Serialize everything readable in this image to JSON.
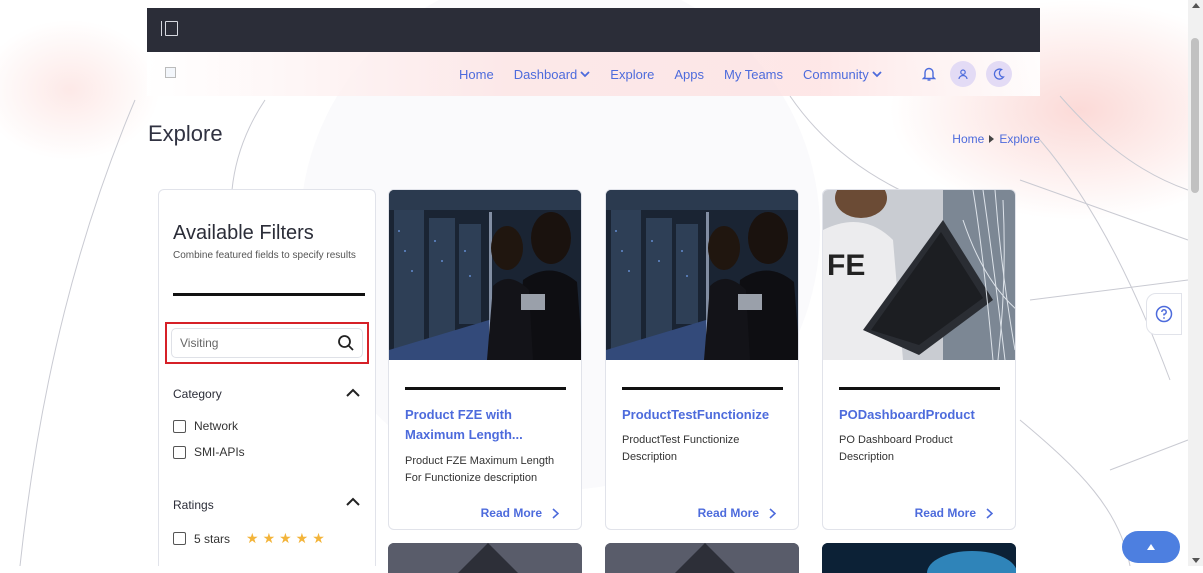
{
  "nav": {
    "links": [
      {
        "label": "Home",
        "has_dropdown": false
      },
      {
        "label": "Dashboard",
        "has_dropdown": true
      },
      {
        "label": "Explore",
        "has_dropdown": false
      },
      {
        "label": "Apps",
        "has_dropdown": false
      },
      {
        "label": "My Teams",
        "has_dropdown": false
      },
      {
        "label": "Community",
        "has_dropdown": true
      }
    ],
    "icons": [
      "bell-icon",
      "user-icon",
      "moon-icon"
    ],
    "accent": "#4d6bdc"
  },
  "page": {
    "title": "Explore",
    "breadcrumb": {
      "home": "Home",
      "current": "Explore"
    }
  },
  "filters": {
    "title": "Available Filters",
    "subtitle": "Combine featured fields to specify results",
    "search": {
      "value": "Visiting",
      "placeholder": ""
    },
    "category": {
      "heading": "Category",
      "options": [
        {
          "label": "Network",
          "checked": false
        },
        {
          "label": "SMI-APIs",
          "checked": false
        }
      ]
    },
    "ratings": {
      "heading": "Ratings",
      "options": [
        {
          "label": "5 stars",
          "stars": 5,
          "checked": false
        }
      ]
    }
  },
  "cards": [
    {
      "title": "Product FZE with Maximum Length...",
      "description": "Product FZE Maximum Length For Functionize description",
      "read_more": "Read More",
      "image": "datacenter-photo"
    },
    {
      "title": "ProductTestFunctionize",
      "description": "ProductTest Functionize Description",
      "read_more": "Read More",
      "image": "datacenter-photo"
    },
    {
      "title": "PODashboardProduct",
      "description": "PO Dashboard Product Description",
      "read_more": "Read More",
      "image": "engineer-laptop-photo"
    }
  ],
  "colors": {
    "topbar": "#2b2d38",
    "link": "#4d6bdc",
    "highlight_border": "#d62027",
    "star": "#f3b43a",
    "scroll_top_button": "#4d7fe0"
  }
}
